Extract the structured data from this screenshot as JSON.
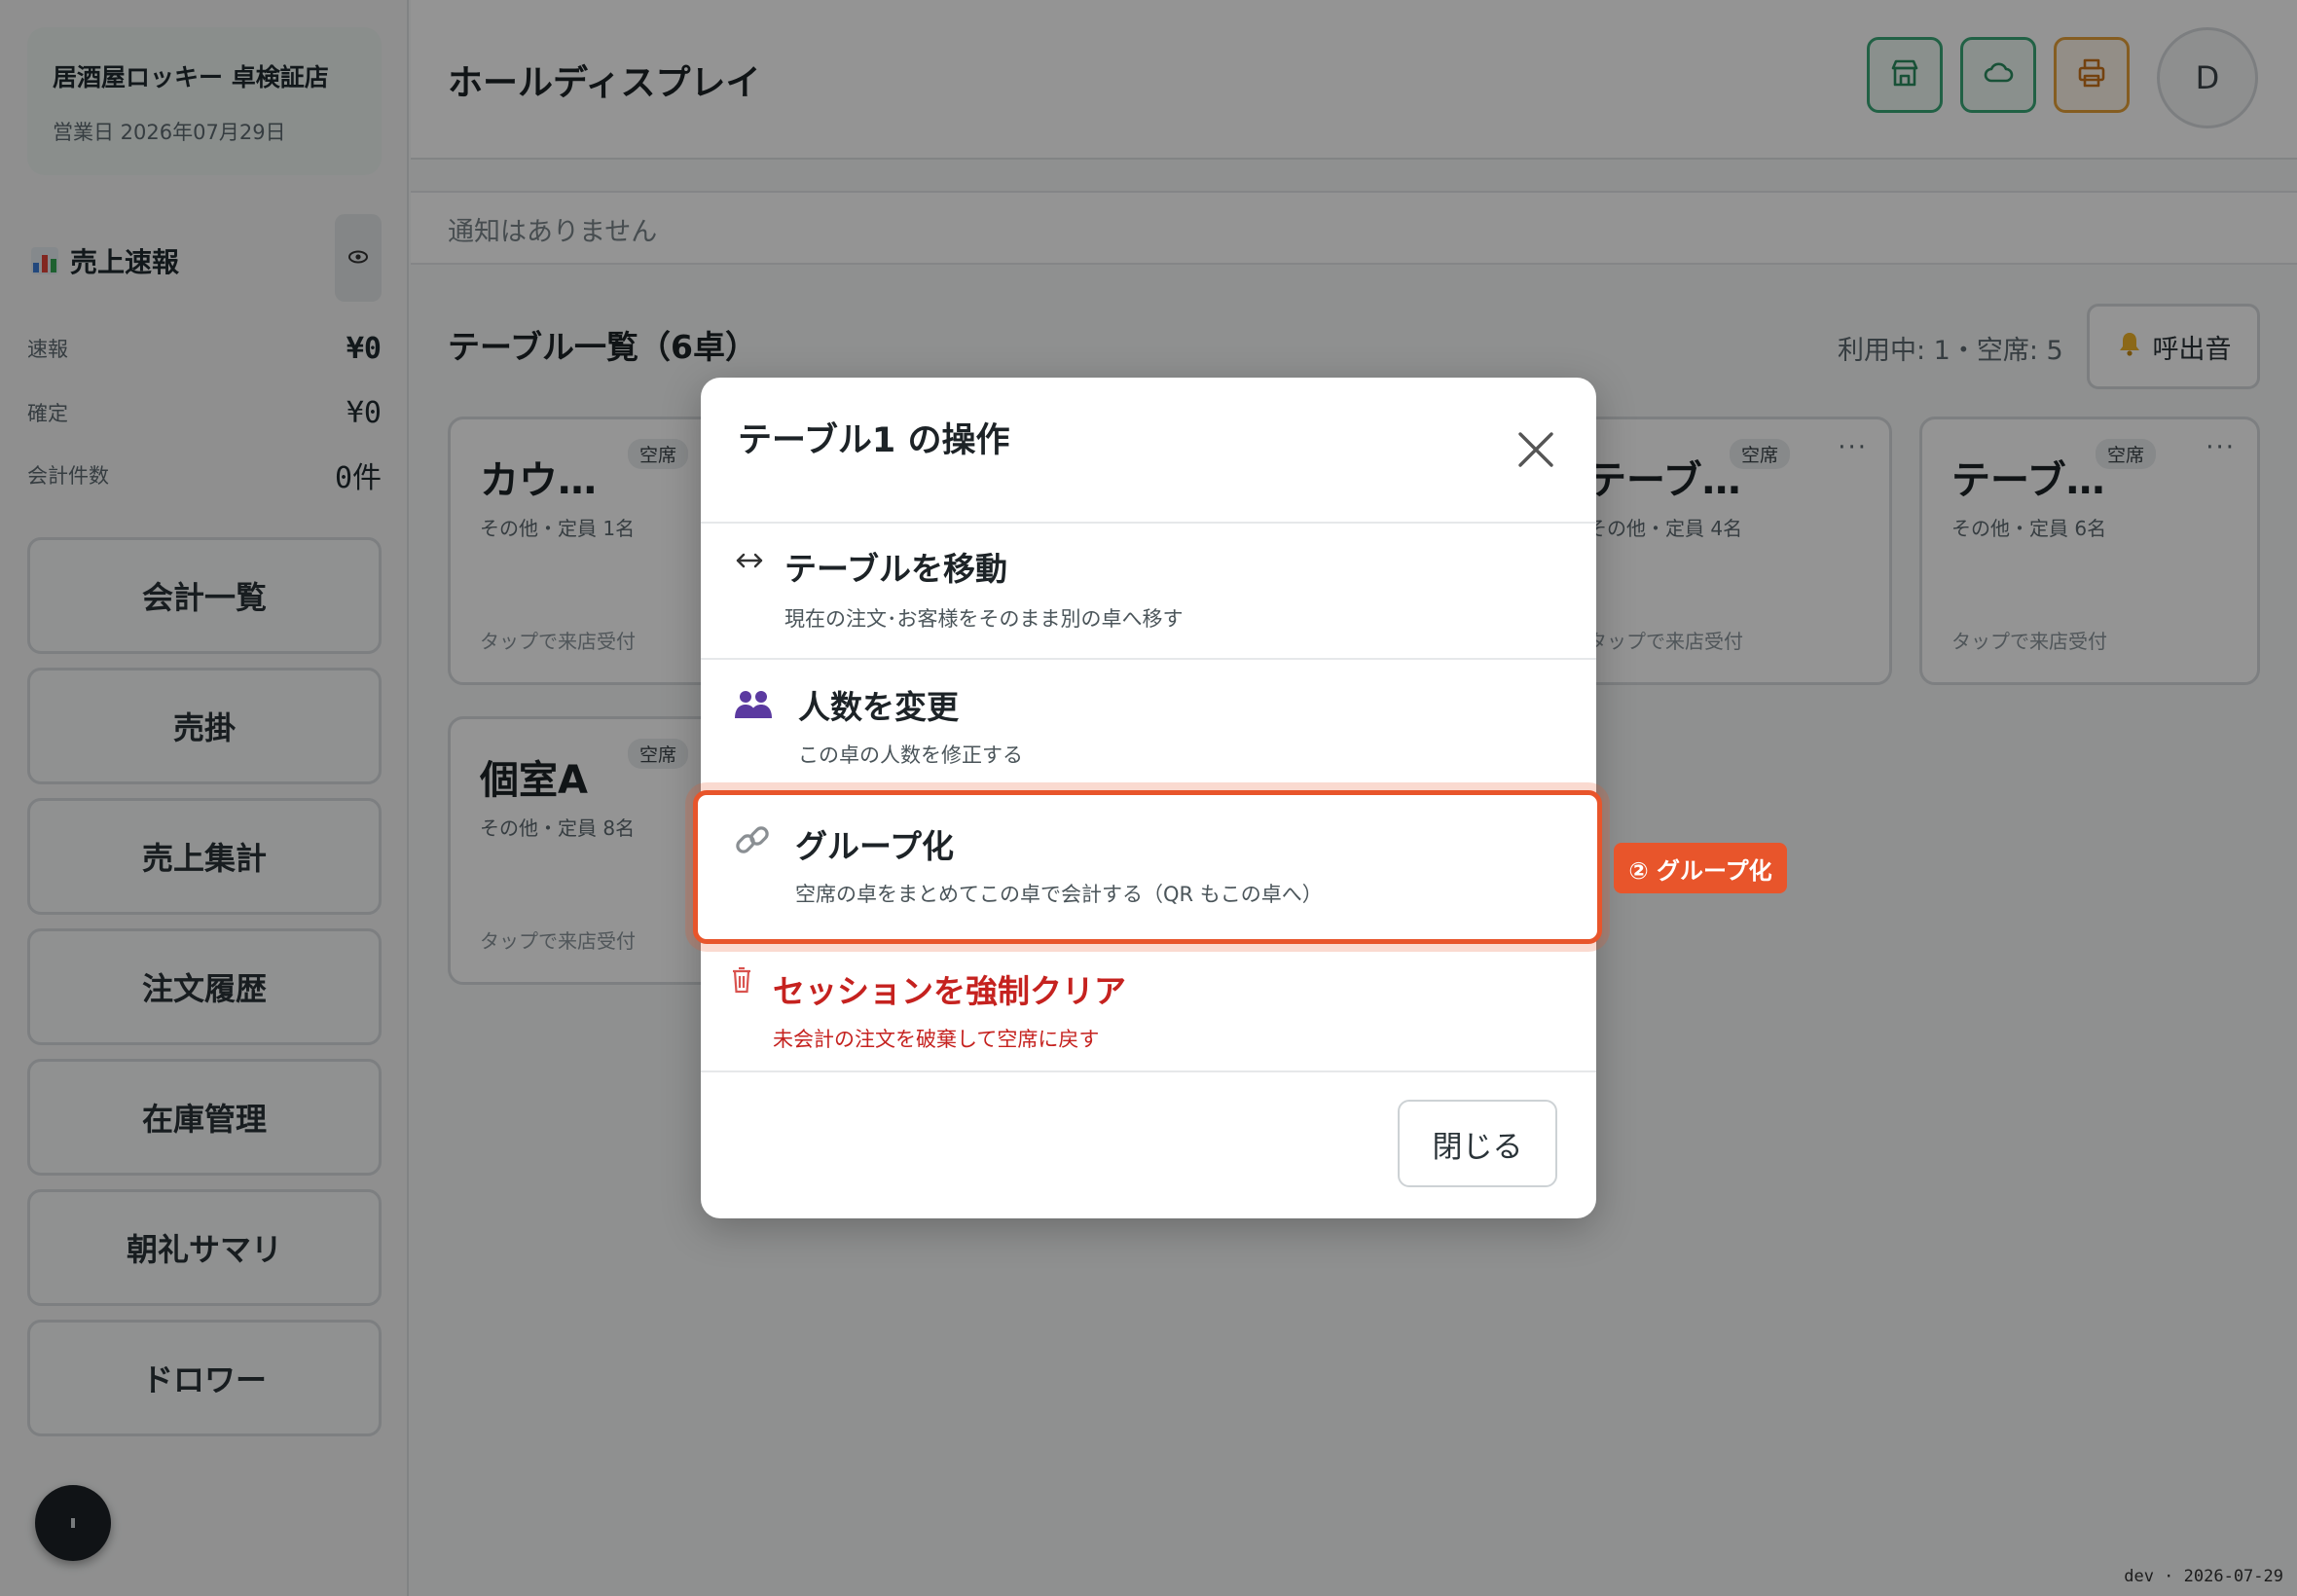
{
  "store": {
    "name": "居酒屋ロッキー 卓検証店",
    "business_date": "営業日 2026年07月29日"
  },
  "sales_flash": {
    "title": "売上速報",
    "stats": [
      {
        "label": "速報",
        "value": "¥0"
      },
      {
        "label": "確定",
        "value": "¥0"
      },
      {
        "label": "会計件数",
        "value": "0件"
      }
    ]
  },
  "nav": [
    {
      "label": "会計一覧"
    },
    {
      "label": "売掛"
    },
    {
      "label": "売上集計"
    },
    {
      "label": "注文履歴"
    },
    {
      "label": "在庫管理"
    },
    {
      "label": "朝礼サマリ"
    },
    {
      "label": "ドロワー"
    }
  ],
  "header": {
    "title": "ホールディスプレイ",
    "avatar_initial": "D",
    "buttons": [
      "store-icon",
      "cloud-icon",
      "printer-icon"
    ]
  },
  "notice": {
    "text": "通知はありません"
  },
  "tables": {
    "title": "テーブル一覧（6卓）",
    "usage": "利用中: 1・空席: 5",
    "call_sound": "呼出音",
    "cards": [
      {
        "name": "カウ…",
        "status": "空席",
        "capacity": "その他・定員 1名",
        "hint": "タップで来店受付"
      },
      {
        "name": "テーブ…",
        "status": "空席",
        "capacity": "その他・定員 4名",
        "hint": "タップで来店受付"
      },
      {
        "name": "テーブ…",
        "status": "空席",
        "capacity": "その他・定員 6名",
        "hint": "タップで来店受付"
      },
      {
        "name": "個室A",
        "status": "空席",
        "capacity": "その他・定員 8名",
        "hint": "タップで来店受付"
      }
    ]
  },
  "modal": {
    "title": "テーブル1 の操作",
    "options": [
      {
        "title": "テーブルを移動",
        "desc": "現在の注文･お客様をそのまま別の卓へ移す",
        "icon": "arrows-horizontal-icon"
      },
      {
        "title": "人数を変更",
        "desc": "この卓の人数を修正する",
        "icon": "people-icon"
      },
      {
        "title": "グループ化",
        "desc": "空席の卓をまとめてこの卓で会計する（QR もこの卓へ）",
        "icon": "link-icon"
      },
      {
        "title": "セッションを強制クリア",
        "desc": "未会計の注文を破棄して空席に戻す",
        "icon": "trash-icon"
      }
    ],
    "close_label": "閉じる"
  },
  "callout": {
    "label": "② グループ化"
  },
  "footer": {
    "tag": "dev · 2026-07-29"
  },
  "colors": {
    "accent_green": "#3aa777",
    "accent_orange": "#e6a13a",
    "highlight": "#e8552b",
    "danger": "#c5221f"
  }
}
